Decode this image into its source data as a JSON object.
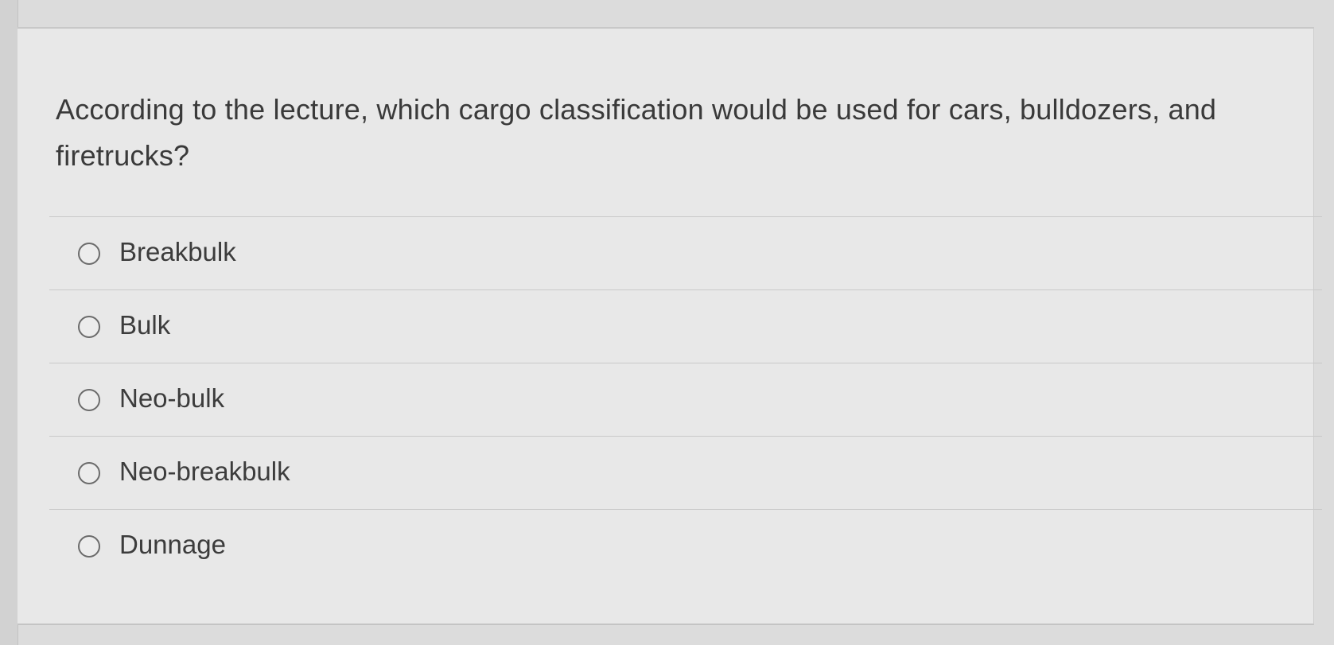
{
  "question": {
    "text": "According to the lecture, which cargo classification would be used for cars, bulldozers, and firetrucks?"
  },
  "options": [
    {
      "label": "Breakbulk"
    },
    {
      "label": "Bulk"
    },
    {
      "label": "Neo-bulk"
    },
    {
      "label": "Neo-breakbulk"
    },
    {
      "label": "Dunnage"
    }
  ]
}
